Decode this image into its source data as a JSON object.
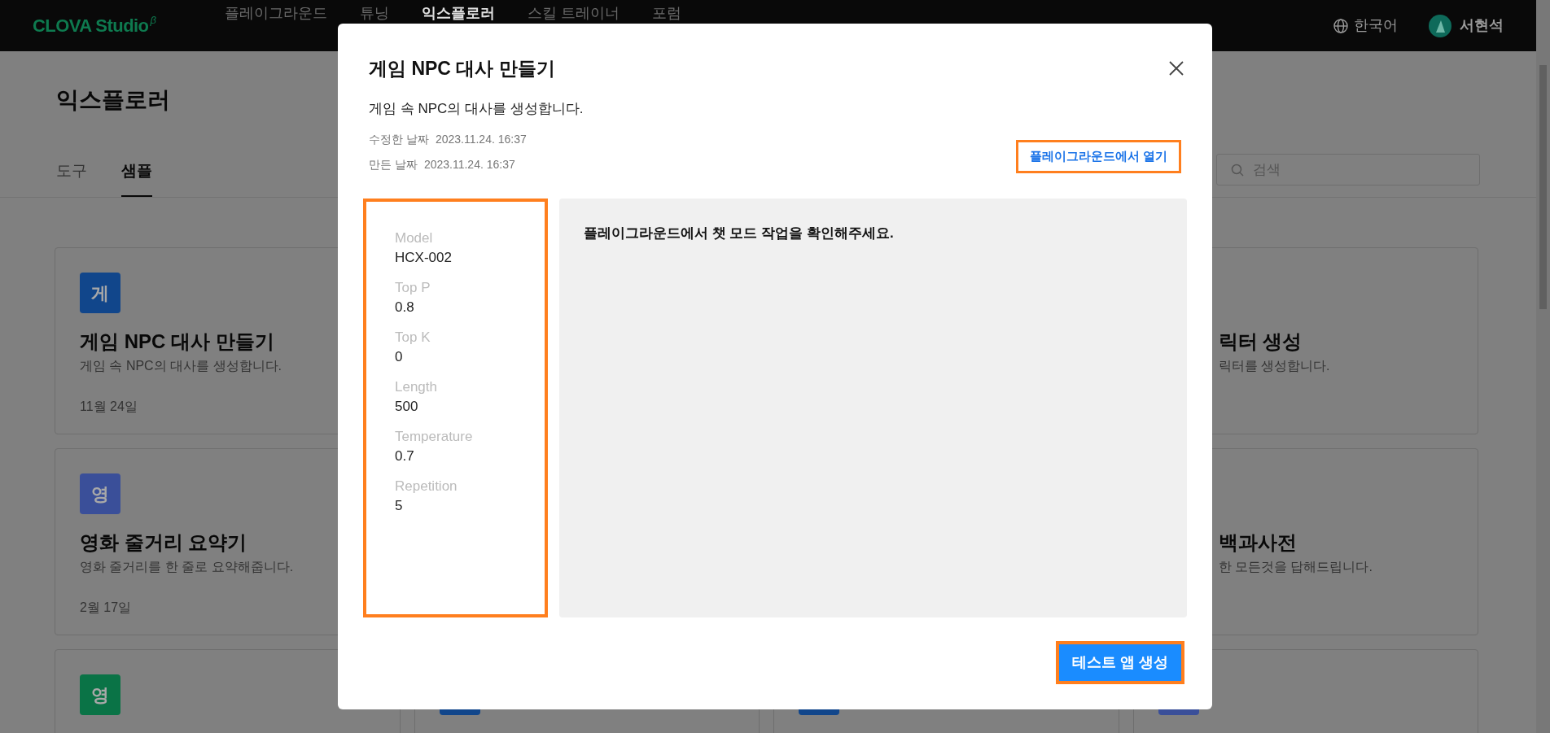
{
  "topbar": {
    "logo": "CLOVA Studio",
    "logo_mark": "β",
    "nav": [
      {
        "label": "플레이그라운드",
        "selected": false
      },
      {
        "label": "튜닝",
        "selected": false
      },
      {
        "label": "익스플로러",
        "selected": true
      },
      {
        "label": "스킬 트레이너",
        "selected": false
      },
      {
        "label": "포럼",
        "selected": false
      }
    ],
    "language": "한국어",
    "user": "서현석"
  },
  "page": {
    "title": "익스플로러",
    "tabs": [
      {
        "label": "도구",
        "selected": false
      },
      {
        "label": "샘플",
        "selected": true
      }
    ],
    "search": {
      "placeholder": "검색"
    },
    "cards": [
      {
        "kind": "full",
        "icon": "게",
        "color": "#11468b",
        "title": "게임 NPC 대사 만들기",
        "description": "게임 속 NPC의 대사를 생성합니다.",
        "date": "11월 24일"
      },
      {
        "kind": "partial",
        "title": "릭터 생성",
        "description": "릭터를 생성합니다."
      },
      {
        "kind": "full",
        "icon": "영",
        "color": "#3a4f99",
        "title": "영화 줄거리 요약기",
        "description": "영화 줄거리를 한 줄로 요약해줍니다.",
        "date": "2월 17일"
      },
      {
        "kind": "partial",
        "title": "백과사전",
        "description": "한 모든것을 답해드립니다."
      },
      {
        "kind": "full",
        "icon": "영",
        "color": "#0a7346"
      },
      {
        "kind": "covered",
        "color": "#11468b"
      },
      {
        "kind": "covered",
        "color": "#11468b"
      },
      {
        "kind": "covered",
        "color": "#3a4f99"
      }
    ]
  },
  "dialog": {
    "title": "게임 NPC 대사 만들기",
    "description": "게임 속 NPC의 대사를 생성합니다.",
    "meta": [
      {
        "label": "수정한 날짜",
        "value": "2023.11.24. 16:37"
      },
      {
        "label": "만든 날짜",
        "value": "2023.11.24. 16:37"
      }
    ],
    "open_link": {
      "label": "플레이그라운드에서 열기",
      "highlighted": true
    },
    "params": {
      "highlighted": true,
      "items": [
        {
          "label": "Model",
          "value": "HCX-002"
        },
        {
          "label": "Top P",
          "value": "0.8"
        },
        {
          "label": "Top K",
          "value": "0"
        },
        {
          "label": "Length",
          "value": "500"
        },
        {
          "label": "Temperature",
          "value": "0.7"
        },
        {
          "label": "Repetition",
          "value": "5"
        }
      ]
    },
    "message": "플레이그라운드에서 챗 모드 작업을 확인해주세요.",
    "create_button": {
      "label": "테스트 앱 생성",
      "highlighted": true
    }
  }
}
